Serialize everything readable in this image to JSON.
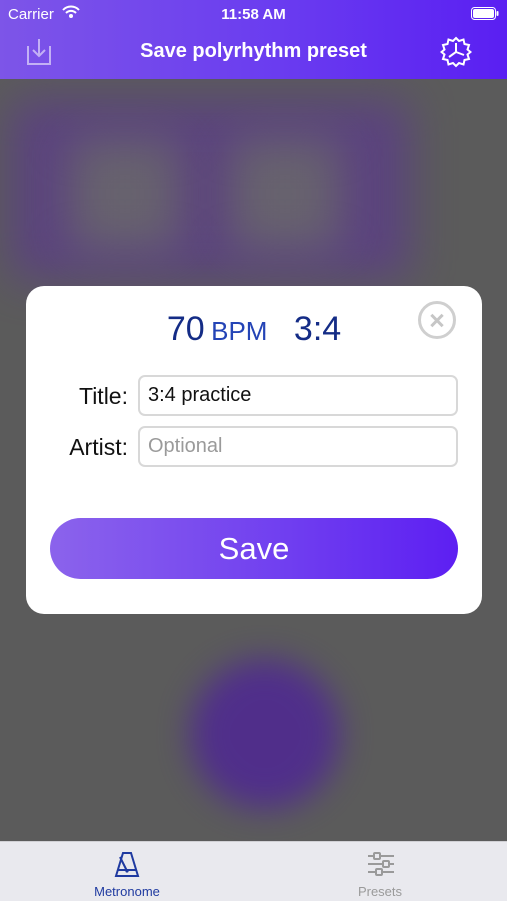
{
  "status_bar": {
    "carrier": "Carrier",
    "time": "11:58 AM",
    "wifi_icon": "wifi-icon",
    "battery_icon": "battery-icon"
  },
  "nav": {
    "title": "Save polyrhythm preset",
    "left_icon": "import-icon",
    "right_icon": "settings-icon"
  },
  "modal": {
    "bpm_value": "70",
    "bpm_unit": "BPM",
    "ratio": "3:4",
    "title_label": "Title:",
    "title_value": "3:4 practice",
    "artist_label": "Artist:",
    "artist_placeholder": "Optional",
    "save_label": "Save",
    "close_icon": "close-icon"
  },
  "tabbar": {
    "tabs": [
      {
        "label": "Metronome",
        "icon": "metronome-icon",
        "selected": true
      },
      {
        "label": "Presets",
        "icon": "sliders-icon",
        "selected": false
      }
    ]
  },
  "colors": {
    "accent": "#6a3cf0",
    "accent_dark": "#5a1ff2",
    "tempo_text": "#142c86",
    "tab_selected": "#1f3aa0"
  }
}
